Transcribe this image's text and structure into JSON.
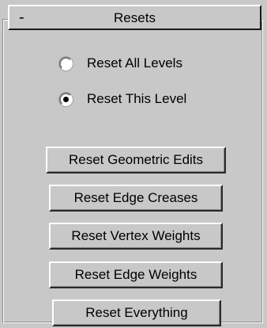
{
  "rollout": {
    "title": "Resets",
    "collapse_symbol": "-"
  },
  "radio_options": [
    {
      "label": "Reset All Levels",
      "selected": false
    },
    {
      "label": "Reset This Level",
      "selected": true
    }
  ],
  "buttons": [
    {
      "label": "Reset Geometric Edits"
    },
    {
      "label": "Reset Edge Creases"
    },
    {
      "label": "Reset Vertex Weights"
    },
    {
      "label": "Reset Edge Weights"
    },
    {
      "label": "Reset Everything"
    }
  ]
}
